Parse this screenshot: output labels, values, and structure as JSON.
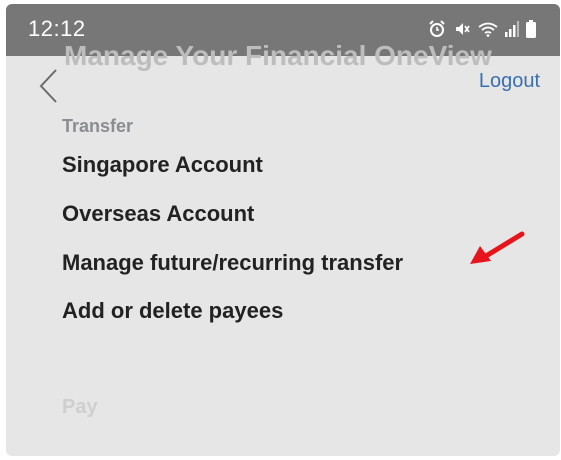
{
  "status_bar": {
    "time": "12:12",
    "icons": [
      "alarm-icon",
      "mute-icon",
      "wifi-icon",
      "signal-icon",
      "battery-icon"
    ]
  },
  "header": {
    "ghost_title": "Manage Your Financial OneView",
    "back_icon": "chevron-left-icon",
    "logout_label": "Logout"
  },
  "transfer": {
    "section_label": "Transfer",
    "items": [
      {
        "label": "Singapore Account"
      },
      {
        "label": "Overseas Account"
      },
      {
        "label": "Manage future/recurring transfer"
      },
      {
        "label": "Add or delete payees"
      }
    ]
  },
  "pay": {
    "section_label": "Pay"
  },
  "annotation": {
    "icon": "red-arrow-icon",
    "color": "#e8141b"
  },
  "colors": {
    "link": "#3a6fb0",
    "status_bar_bg": "#777777",
    "screen_bg": "#e6e6e6"
  }
}
